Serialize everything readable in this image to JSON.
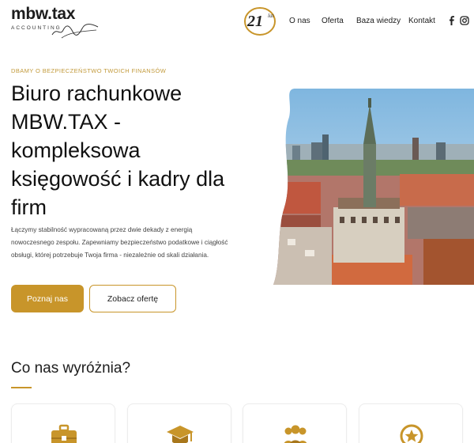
{
  "header": {
    "logo_title": "mbw.tax",
    "logo_subtitle": "ACCOUNTING",
    "badge_number": "21",
    "badge_suffix": "lat",
    "nav": [
      "O nas",
      "Oferta",
      "Baza wiedzy",
      "Kontakt"
    ],
    "social_icons": [
      "facebook-icon",
      "instagram-icon"
    ]
  },
  "hero": {
    "eyebrow": "DBAMY O BEZPIECZEŃSTWO TWOICH FINANSÓW",
    "title_lines": [
      "Biuro rachunkowe",
      "MBW.TAX -",
      "kompleksowa",
      "księgowość i kadry dla",
      "firm"
    ],
    "description": "Łączymy stabilność wypracowaną przez dwie dekady z energią nowoczesnego zespołu. Zapewniamy bezpieczeństwo podatkowe i ciągłość obsługi, której potrzebuje Twoja firma - niezależnie od skali działania.",
    "primary_button": "Poznaj nas",
    "secondary_button": "Zobacz ofertę",
    "image_subject": "aerial-city-photo"
  },
  "features": {
    "title": "Co nas wyróżnia?",
    "card_icons": [
      "briefcase-icon",
      "graduation-cap-icon",
      "team-icon",
      "star-badge-icon"
    ]
  },
  "colors": {
    "accent": "#c8952a",
    "eyebrow": "#c29a3b",
    "text": "#1d1d1d"
  }
}
